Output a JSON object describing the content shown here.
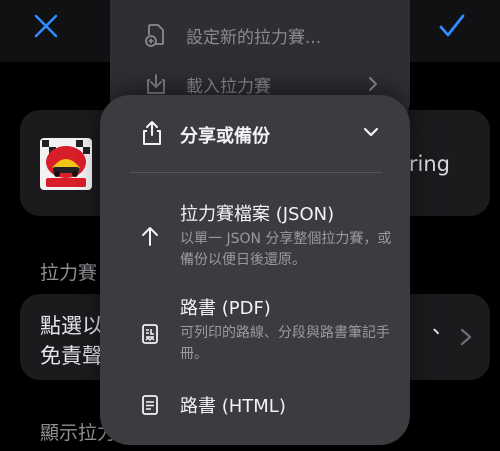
{
  "nav": {
    "close_icon": "xmark-icon",
    "done_icon": "checkmark-icon",
    "accent": "#2f8dff"
  },
  "rally_card": {
    "badge_top_text": "SUPER STAGE CLASSIC",
    "badge_bottom_text": "CHALLENGE",
    "name_suffix": "uring"
  },
  "sections": {
    "rally_section_label": "拉力賽",
    "display_section_label": "顯示拉力"
  },
  "disclaimer": {
    "line1": "點選以",
    "line2": "免責聲",
    "trailing": "、"
  },
  "back_menu": {
    "items": [
      {
        "label": "設定新的拉力賽...",
        "icon": "new-document-icon"
      },
      {
        "label": "載入拉力賽",
        "icon": "download-tray-icon"
      }
    ]
  },
  "share_menu": {
    "title": "分享或備份",
    "icon": "share-icon",
    "items": [
      {
        "title": "拉力賽檔案 (JSON)",
        "desc": "以單一 JSON 分享整個拉力賽，或備份以便日後還原。",
        "icon": "arrow-up-icon"
      },
      {
        "title": "路書 (PDF)",
        "desc": "可列印的路線、分段與路書筆記手冊。",
        "icon": "roadbook-icon"
      },
      {
        "title": "路書 (HTML)",
        "desc": "",
        "icon": "document-icon"
      }
    ]
  }
}
